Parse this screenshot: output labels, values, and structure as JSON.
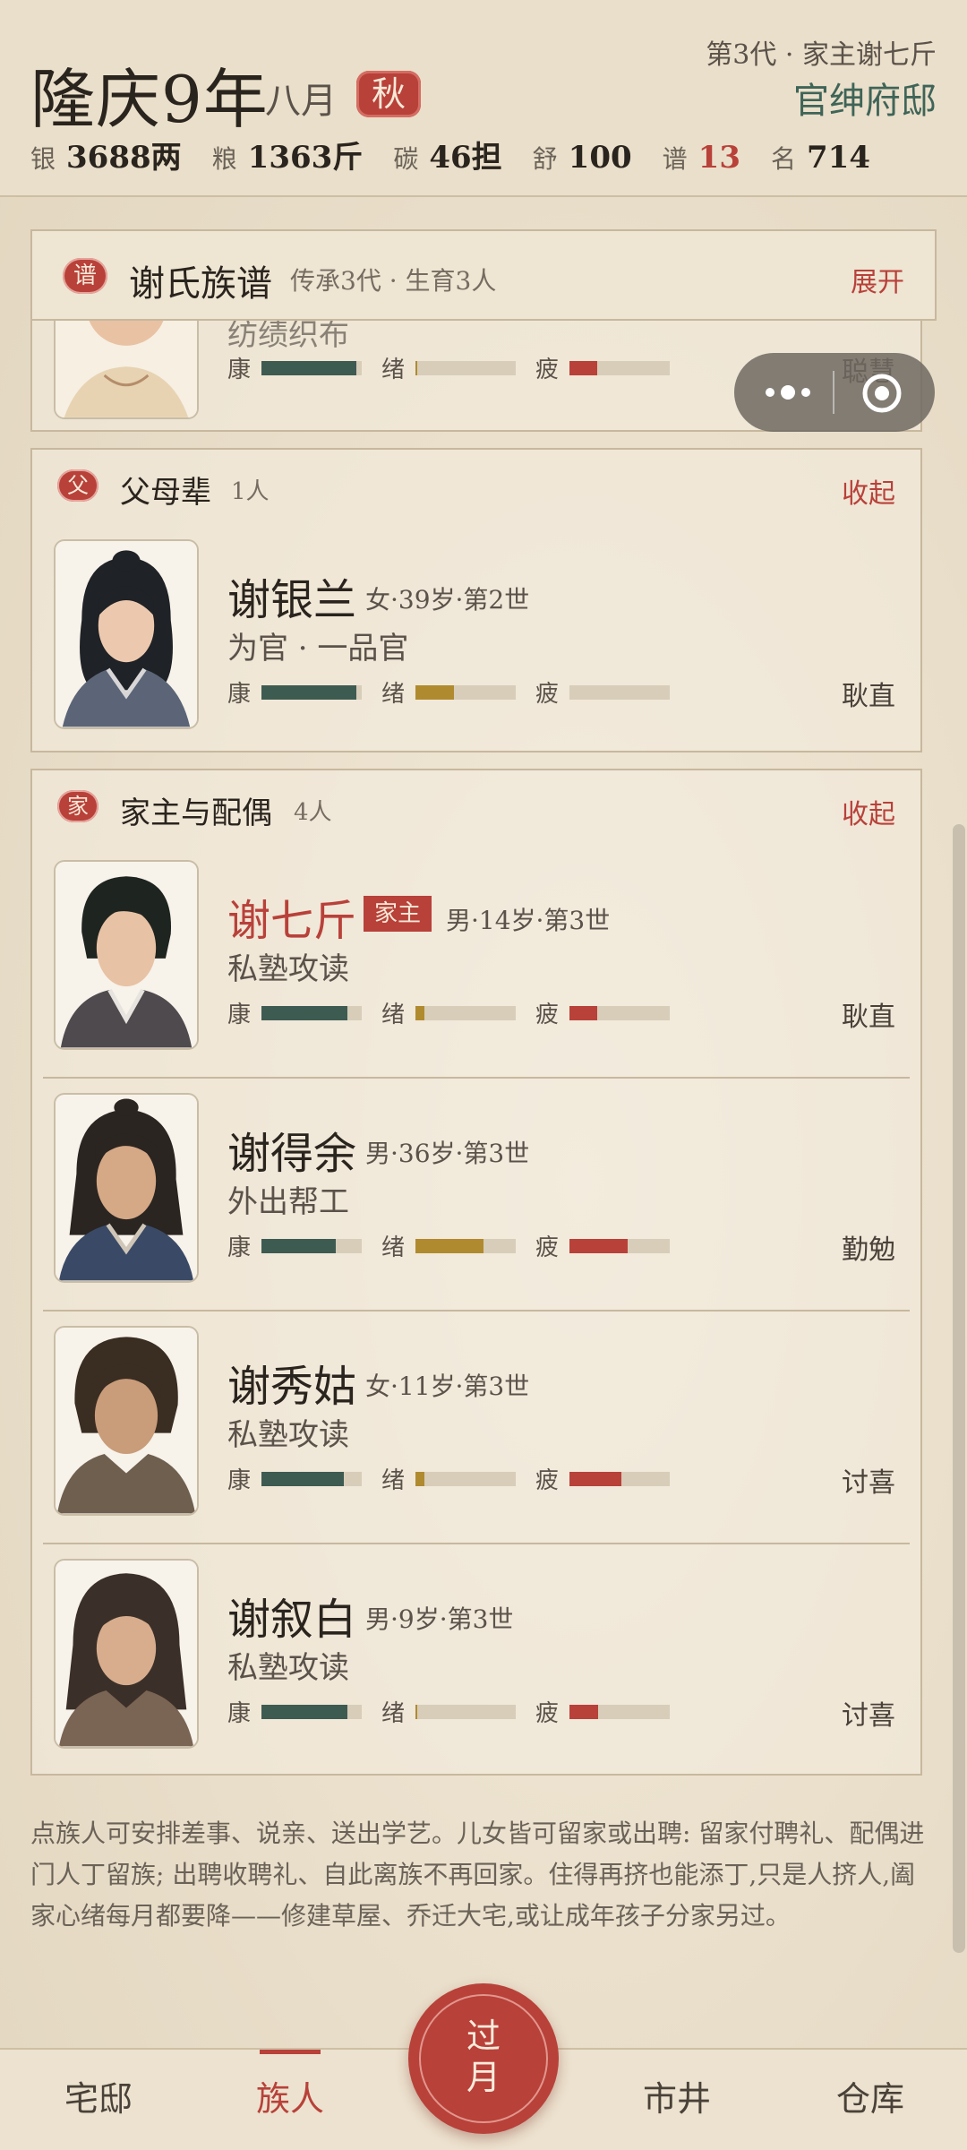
{
  "header": {
    "era": "隆庆9年",
    "month": "八月",
    "season": "秋",
    "generation": "第3代 · 家主谢七斤",
    "estate": "官绅府邸",
    "stats": [
      {
        "label": "银",
        "value": "3688两"
      },
      {
        "label": "粮",
        "value": "1363斤"
      },
      {
        "label": "碳",
        "value": "46担"
      },
      {
        "label": "舒",
        "value": "100"
      },
      {
        "label": "谱",
        "value": "13"
      },
      {
        "label": "名",
        "value": "714"
      }
    ]
  },
  "clan": {
    "seal": "谱",
    "title": "谢氏族谱",
    "subtitle": "传承3代 · 生育3人",
    "toggle": "展开"
  },
  "partial_member": {
    "job": "纺绩织布",
    "trait": "聪慧",
    "health": 0.95,
    "mood": 0.02,
    "fatigue": 0.28
  },
  "sections": [
    {
      "seal": "父",
      "title": "父母辈",
      "count": "1人",
      "toggle": "收起",
      "members": [
        {
          "name": "谢银兰",
          "meta": "女·39岁·第2世",
          "job": "为官 · 一品官",
          "trait": "耿直",
          "health": 0.95,
          "mood": 0.38,
          "fatigue": 0.0
        }
      ]
    },
    {
      "seal": "家",
      "title": "家主与配偶",
      "count": "4人",
      "toggle": "收起",
      "members": [
        {
          "name": "谢七斤",
          "badge": "家主",
          "meta": "男·14岁·第3世",
          "job": "私塾攻读",
          "trait": "耿直",
          "health": 0.86,
          "mood": 0.09,
          "fatigue": 0.28
        },
        {
          "name": "谢得余",
          "meta": "男·36岁·第3世",
          "job": "外出帮工",
          "trait": "勤勉",
          "health": 0.74,
          "mood": 0.68,
          "fatigue": 0.58
        },
        {
          "name": "谢秀姑",
          "meta": "女·11岁·第3世",
          "job": "私塾攻读",
          "trait": "讨喜",
          "health": 0.82,
          "mood": 0.09,
          "fatigue": 0.52
        },
        {
          "name": "谢叙白",
          "meta": "男·9岁·第3世",
          "job": "私塾攻读",
          "trait": "讨喜",
          "health": 0.86,
          "mood": 0.02,
          "fatigue": 0.29
        }
      ]
    }
  ],
  "bar_labels": {
    "health": "康",
    "mood": "绪",
    "fatigue": "疲"
  },
  "tip": "点族人可安排差事、说亲、送出学艺。儿女皆可留家或出聘: 留家付聘礼、配偶进门人丁留族; 出聘收聘礼、自此离族不再回家。住得再挤也能添丁,只是人挤人,阖家心绪每月都要降——修建草屋、乔迁大宅,或让成年孩子分家另过。",
  "nav": {
    "home": "宅邸",
    "clan": "族人",
    "end_month": "过月",
    "market": "市井",
    "storage": "仓库"
  },
  "colors": {
    "accent": "#b8413a",
    "estate": "#3f6458",
    "health": "#3e5b52",
    "mood": "#b08a2e",
    "fatigue": "#b8413a",
    "background": "#e9dfcb"
  },
  "icons": [
    "more-dots-icon",
    "close-target-icon"
  ]
}
